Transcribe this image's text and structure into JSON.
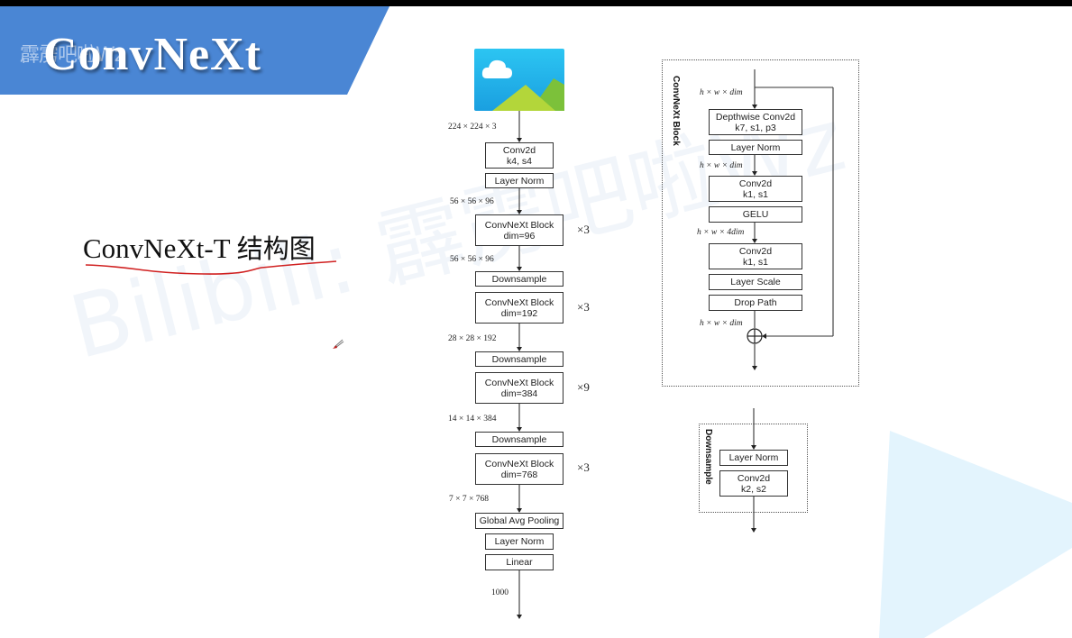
{
  "slide": {
    "title": "ConvNeXt",
    "banner_watermark": "霹雳吧啦Wz",
    "subtitle_latin": "ConvNeXt-T ",
    "subtitle_cn": "结构图",
    "watermark": "Bilibili: 霹雳吧啦Wz",
    "colors": {
      "banner": "#4a86d4",
      "annotation": "#d02020",
      "deco": "#e3f4fd"
    }
  },
  "main_path": {
    "input_icon": "image-icon",
    "input_dim": "224 × 224 × 3",
    "stem": [
      {
        "line1": "Conv2d",
        "line2": "k4, s4"
      },
      {
        "line1": "Layer Norm"
      }
    ],
    "dims": [
      "56 × 56 × 96",
      "56 × 56 × 96",
      "28 × 28 × 192",
      "14 × 14 × 384",
      "7 × 7 × 768"
    ],
    "stages": [
      {
        "downsample": null,
        "block": "ConvNeXt Block",
        "dim": "dim=96",
        "repeat": "×3"
      },
      {
        "downsample": "Downsample",
        "block": "ConvNeXt Block",
        "dim": "dim=192",
        "repeat": "×3"
      },
      {
        "downsample": "Downsample",
        "block": "ConvNeXt Block",
        "dim": "dim=384",
        "repeat": "×9"
      },
      {
        "downsample": "Downsample",
        "block": "ConvNeXt Block",
        "dim": "dim=768",
        "repeat": "×3"
      }
    ],
    "head": [
      "Global Avg Pooling",
      "Layer Norm",
      "Linear"
    ],
    "output_dim": "1000"
  },
  "block_detail": {
    "label": "ConvNeXt Block",
    "dims": [
      "h × w × dim",
      "h × w × dim",
      "h × w × 4dim",
      "h × w × dim"
    ],
    "layers": [
      {
        "line1": "Depthwise Conv2d",
        "line2": "k7, s1, p3"
      },
      {
        "line1": "Layer Norm"
      },
      {
        "line1": "Conv2d",
        "line2": "k1, s1"
      },
      {
        "line1": "GELU"
      },
      {
        "line1": "Conv2d",
        "line2": "k1, s1"
      },
      {
        "line1": "Layer Scale"
      },
      {
        "line1": "Drop Path"
      }
    ],
    "add_symbol": "⊕"
  },
  "downsample_detail": {
    "label": "Downsample",
    "layers": [
      {
        "line1": "Layer Norm"
      },
      {
        "line1": "Conv2d",
        "line2": "k2, s2"
      }
    ]
  }
}
